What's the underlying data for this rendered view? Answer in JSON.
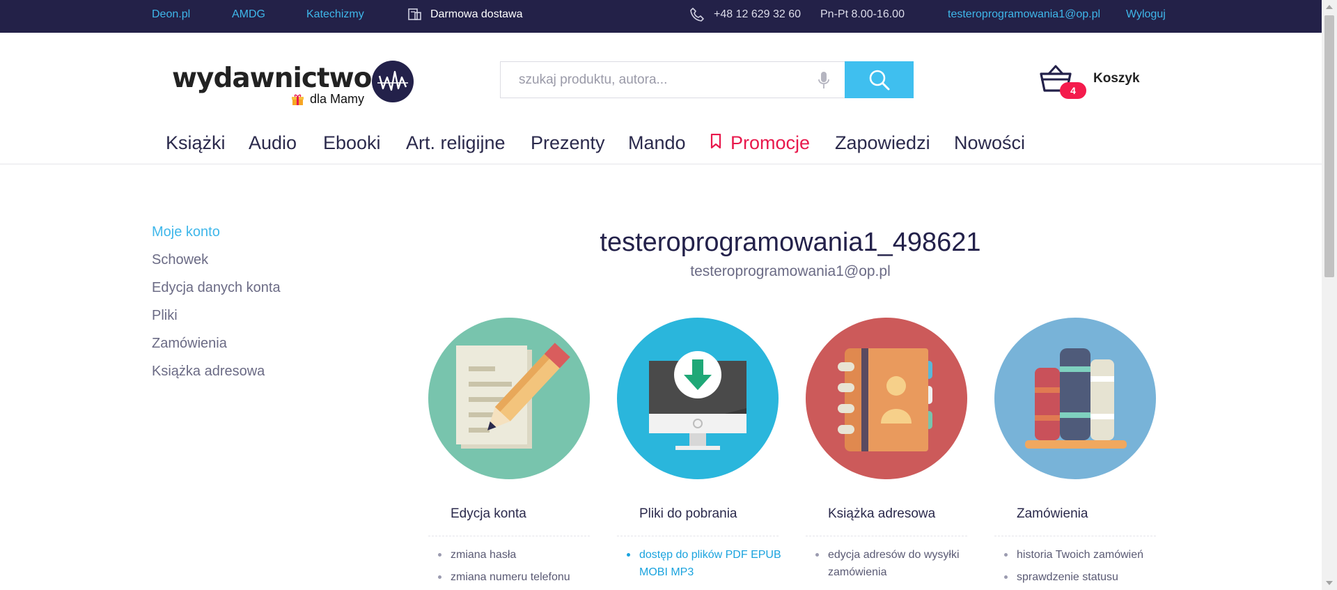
{
  "topbar": {
    "link_deon": "Deon.pl",
    "link_amdg": "AMDG",
    "link_katechizmy": "Katechizmy",
    "shipping_icon": "package-icon",
    "shipping": "Darmowa dostawa",
    "phone_icon": "phone-icon",
    "phone": "+48 12 629 32 60",
    "hours": "Pn-Pt 8.00-16.00",
    "user_email": "testeroprogramowania1@op.pl",
    "logout": "Wyloguj"
  },
  "header": {
    "logo_text": "wydawnictwo",
    "logo_badge": "WAM",
    "logo_sub": "dla Mamy",
    "search_placeholder": "szukaj produktu, autora...",
    "mic_icon": "microphone-icon",
    "search_icon": "search-icon",
    "cart_icon": "basket-icon",
    "cart_count": "4",
    "cart_label": "Koszyk"
  },
  "nav": {
    "items": [
      "Książki",
      "Audio",
      "Ebooki",
      "Art. religijne",
      "Prezenty",
      "Mando",
      "Promocje",
      "Zapowiedzi",
      "Nowości"
    ],
    "promo_icon": "bookmark-icon",
    "promo_color": "#e8184c"
  },
  "sidebar": {
    "items": [
      "Moje konto",
      "Schowek",
      "Edycja danych konta",
      "Pliki",
      "Zamówienia",
      "Książka adresowa"
    ],
    "active_index": 0
  },
  "profile": {
    "username": "testeroprogramowania1_498621",
    "email": "testeroprogramowania1@op.pl"
  },
  "cards": [
    {
      "title": "Edycja konta",
      "icon": "edit-document-icon",
      "color": "#78c4ad",
      "items": [
        "zmiana hasła",
        "zmiana numeru telefonu"
      ]
    },
    {
      "title": "Pliki do pobrania",
      "icon": "download-monitor-icon",
      "color": "#2ab6dc",
      "items": [
        "dostęp do plików PDF EPUB MOBI MP3"
      ]
    },
    {
      "title": "Książka adresowa",
      "icon": "address-book-icon",
      "color": "#cc5a5a",
      "items": [
        "edycja adresów do wysyłki zamówienia"
      ]
    },
    {
      "title": "Zamówienia",
      "icon": "books-icon",
      "color": "#78b3d8",
      "items": [
        "historia Twoich zamówień",
        "sprawdzenie statusu"
      ]
    }
  ],
  "colors": {
    "topbar_bg": "#232148",
    "accent": "#3fb7ea",
    "badge": "#f41b4c"
  }
}
